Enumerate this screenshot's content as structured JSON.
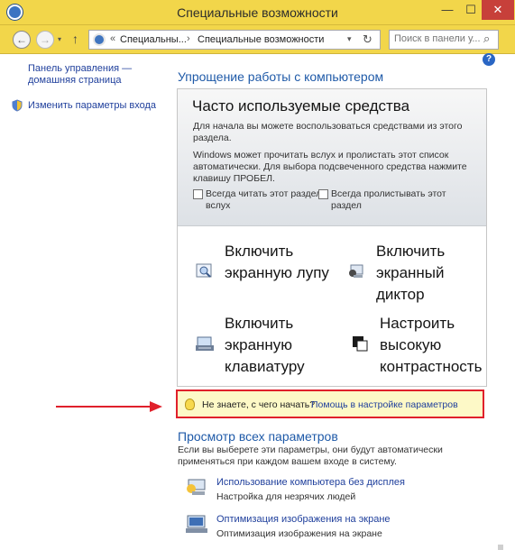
{
  "window": {
    "title": "Специальные возможности",
    "controls": {
      "minimize": "—",
      "maximize": "☐",
      "close": "✕"
    }
  },
  "address_bar": {
    "prefix": "«",
    "crumbs": [
      "Специальны...",
      "Специальные возможности"
    ],
    "separator": "›",
    "dropdown": "▾",
    "refresh": "↻"
  },
  "search": {
    "placeholder": "Поиск в панели у..."
  },
  "nav": {
    "back": "←",
    "forward": "→",
    "recent": "▾",
    "up": "↑"
  },
  "left_pane": {
    "home_link": "Панель управления — домашняя страница",
    "change_login": "Изменить параметры входа"
  },
  "help_icon": "?",
  "main": {
    "section_title": "Упрощение работы с компьютером",
    "box": {
      "heading": "Часто используемые средства",
      "desc1": "Для начала вы можете воспользоваться средствами из этого раздела.",
      "desc2": "Windows может прочитать вслух и пролистать этот список автоматически. Для выбора подсвеченного средства нажмите клавишу ПРОБЕЛ.",
      "check_read": "Всегда читать этот раздел вслух",
      "check_scroll": "Всегда пролистывать этот раздел",
      "tools": [
        {
          "label": "Включить экранную лупу",
          "icon": "magnifier-icon"
        },
        {
          "label": "Включить экранный диктор",
          "icon": "narrator-icon"
        },
        {
          "label": "Включить экранную клавиатуру",
          "icon": "keyboard-icon"
        },
        {
          "label": "Настроить высокую контрастность",
          "icon": "contrast-icon"
        }
      ]
    },
    "hint": {
      "question": "Не знаете, с чего начать?",
      "link": "Помощь в настройке параметров"
    },
    "all_settings": {
      "title": "Просмотр всех параметров",
      "desc": "Если вы выберете эти параметры, они будут автоматически применяться при каждом вашем входе в систему.",
      "items": [
        {
          "title": "Использование компьютера без дисплея",
          "subtitle": "Настройка для незрячих людей",
          "icon": "no-display-icon"
        },
        {
          "title": "Оптимизация изображения на экране",
          "subtitle": "Оптимизация изображения на экране",
          "icon": "monitor-icon"
        }
      ]
    }
  },
  "colors": {
    "titlebar": "#f2d64a",
    "link": "#1f3f9c",
    "section_title": "#1f5aa8",
    "hint_border": "#e0202b",
    "arrow": "#e0202b"
  }
}
